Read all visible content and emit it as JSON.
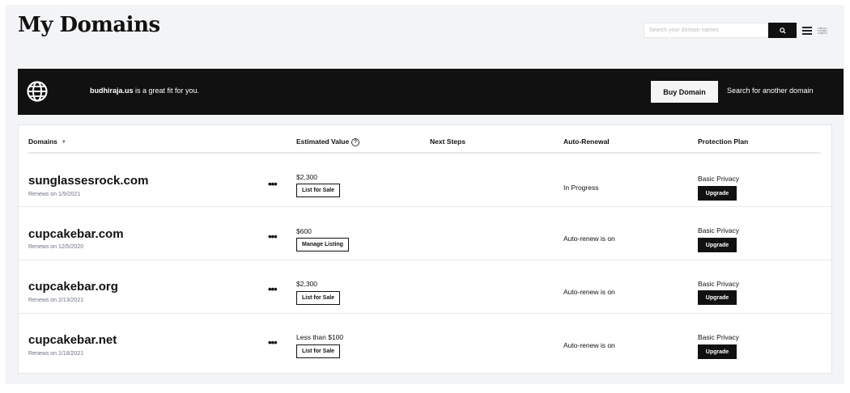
{
  "header": {
    "title": "My Domains",
    "search_placeholder": "Search your domain names"
  },
  "banner": {
    "domain": "budhiraja.us",
    "text": " is a great fit for you.",
    "buy_label": "Buy Domain",
    "search_label": "Search for another domain"
  },
  "table": {
    "headers": [
      "Domains",
      "Estimated Value",
      "Next Steps",
      "Auto-Renewal",
      "Protection Plan"
    ],
    "rows": [
      {
        "domain": "sunglassesrock.com",
        "renews": "Renews on 1/9/2021",
        "value": "$2,300",
        "value_action": "List for Sale",
        "next_steps": "",
        "auto_renewal": "In Progress",
        "plan": "Basic Privacy",
        "plan_action": "Upgrade"
      },
      {
        "domain": "cupcakebar.com",
        "renews": "Renews on 12/5/2020",
        "value": "$600",
        "value_action": "Manage Listing",
        "next_steps": "",
        "auto_renewal": "Auto-renew is on",
        "plan": "Basic Privacy",
        "plan_action": "Upgrade"
      },
      {
        "domain": "cupcakebar.org",
        "renews": "Renews on 2/13/2021",
        "value": "$2,300",
        "value_action": "List for Sale",
        "next_steps": "",
        "auto_renewal": "Auto-renew is on",
        "plan": "Basic Privacy",
        "plan_action": "Upgrade"
      },
      {
        "domain": "cupcakebar.net",
        "renews": "Renews on 1/18/2021",
        "value": "Less than $100",
        "value_action": "List for Sale",
        "next_steps": "",
        "auto_renewal": "Auto-renew is on",
        "plan": "Basic Privacy",
        "plan_action": "Upgrade"
      }
    ]
  },
  "icons": {
    "search": "search-icon",
    "list_view": "list-view-icon",
    "filter": "sliders-icon",
    "globe": "globe-icon",
    "sort": "chevron-down-icon",
    "info": "info-icon",
    "more": "more-horizontal-icon"
  },
  "colors": {
    "background": "#f3f4f6",
    "banner": "#111111",
    "card": "#ffffff",
    "button_dark": "#111111"
  }
}
